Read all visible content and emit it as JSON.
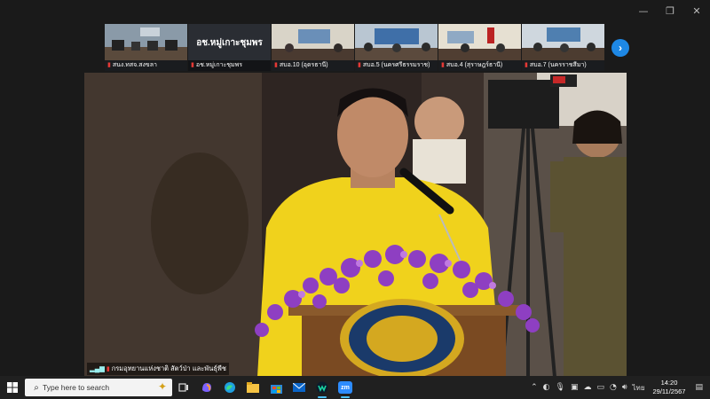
{
  "window": {
    "minimize_icon": "minimize-icon",
    "restore_icon": "restore-icon",
    "close_icon": "close-icon",
    "minimize_glyph": "—",
    "restore_glyph": "❐",
    "close_glyph": "✕"
  },
  "gallery": {
    "tiles": [
      {
        "name": "สนง.ทสจ.สงขลา",
        "kind": "room"
      },
      {
        "name": "อช.หมู่เกาะชุมพร",
        "kind": "text",
        "big": "อช.หมู่เกาะชุมพร"
      },
      {
        "name": "สบอ.10 (อุดรธานี)",
        "kind": "room"
      },
      {
        "name": "สบอ.5 (นครศรีธรรมราช)",
        "kind": "room"
      },
      {
        "name": "สบอ.4 (สุราษฎร์ธานี)",
        "kind": "room"
      },
      {
        "name": "สบอ.7 (นครราชสีมา)",
        "kind": "room"
      }
    ],
    "next_glyph": "›"
  },
  "main_video": {
    "speaker_name": "กรมอุทยานแห่งชาติ สัตว์ป่า และพันธุ์พืช"
  },
  "taskbar": {
    "search_placeholder": "Type here to search",
    "language": "ไทย",
    "time": "14:20",
    "date": "29/11/2567",
    "pinned": [
      "task-view-icon",
      "copilot-icon",
      "edge-icon",
      "file-explorer-icon",
      "store-icon",
      "mail-icon",
      "webex-icon",
      "zoom-icon"
    ],
    "zoom_label": "zm"
  },
  "colors": {
    "accent": "#1e88e5",
    "taskbar": "#202020",
    "shirt": "#f0d21c",
    "orchid": "#8e3fc2"
  }
}
